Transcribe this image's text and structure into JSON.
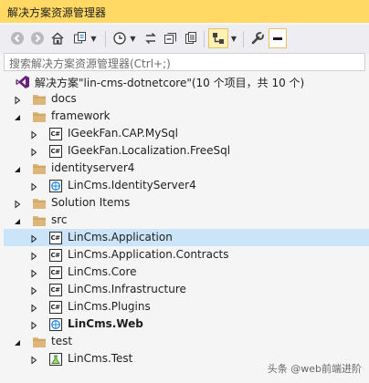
{
  "window": {
    "title": "解决方案资源管理器"
  },
  "toolbar": {
    "icons": [
      "back-icon",
      "forward-icon",
      "home-icon",
      "switch-views-icon",
      "history-icon",
      "sync-icon",
      "collapse-all-icon",
      "show-all-files-icon",
      "preview-icon",
      "properties-icon",
      "pin-icon"
    ]
  },
  "search": {
    "placeholder": "搜索解决方案资源管理器(Ctrl+;)"
  },
  "tree": {
    "solution": {
      "label": "解决方案\"lin-cms-dotnetcore\"(10 个项目，共 10 个)"
    },
    "items": [
      {
        "label": "docs",
        "type": "folder",
        "level": 1,
        "expanded": false,
        "selected": false,
        "bold": false
      },
      {
        "label": "framework",
        "type": "folder",
        "level": 1,
        "expanded": true,
        "selected": false,
        "bold": false
      },
      {
        "label": "IGeekFan.CAP.MySql",
        "type": "csproj",
        "level": 2,
        "expanded": false,
        "selected": false,
        "bold": false
      },
      {
        "label": "IGeekFan.Localization.FreeSql",
        "type": "csproj",
        "level": 2,
        "expanded": false,
        "selected": false,
        "bold": false
      },
      {
        "label": "identityserver4",
        "type": "folder",
        "level": 1,
        "expanded": true,
        "selected": false,
        "bold": false
      },
      {
        "label": "LinCms.IdentityServer4",
        "type": "webproj",
        "level": 2,
        "expanded": false,
        "selected": false,
        "bold": false
      },
      {
        "label": "Solution Items",
        "type": "folder",
        "level": 1,
        "expanded": false,
        "selected": false,
        "bold": false
      },
      {
        "label": "src",
        "type": "folder",
        "level": 1,
        "expanded": true,
        "selected": false,
        "bold": false
      },
      {
        "label": "LinCms.Application",
        "type": "csproj",
        "level": 2,
        "expanded": false,
        "selected": true,
        "bold": false
      },
      {
        "label": "LinCms.Application.Contracts",
        "type": "csproj",
        "level": 2,
        "expanded": false,
        "selected": false,
        "bold": false
      },
      {
        "label": "LinCms.Core",
        "type": "csproj",
        "level": 2,
        "expanded": false,
        "selected": false,
        "bold": false
      },
      {
        "label": "LinCms.Infrastructure",
        "type": "csproj",
        "level": 2,
        "expanded": false,
        "selected": false,
        "bold": false
      },
      {
        "label": "LinCms.Plugins",
        "type": "csproj",
        "level": 2,
        "expanded": false,
        "selected": false,
        "bold": false
      },
      {
        "label": "LinCms.Web",
        "type": "webproj",
        "level": 2,
        "expanded": false,
        "selected": false,
        "bold": true
      },
      {
        "label": "test",
        "type": "folder",
        "level": 1,
        "expanded": true,
        "selected": false,
        "bold": false
      },
      {
        "label": "LinCms.Test",
        "type": "testproj",
        "level": 2,
        "expanded": false,
        "selected": false,
        "bold": false
      }
    ]
  },
  "watermark": {
    "text": "头条 @web前端进阶"
  },
  "colors": {
    "title_bg": "#ffd964",
    "selected_bg": "#cce4f7",
    "folder": "#dcb67a",
    "toolbar_bg": "#eeeef2"
  }
}
